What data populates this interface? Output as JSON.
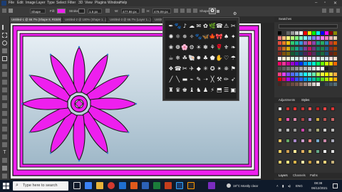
{
  "menu": {
    "items": [
      "File",
      "Edit",
      "Image",
      "Layer",
      "Type",
      "Select",
      "Filter",
      "3D",
      "View",
      "Plugins",
      "Window",
      "Help"
    ]
  },
  "options": {
    "mode_value": "Shape",
    "fill_label": "Fill:",
    "stroke_label": "Stroke:",
    "stroke_width": "1.5 px",
    "w_value": "477.86 px",
    "h_value": "478.09 px",
    "shape_label": "Shape:"
  },
  "tabs": [
    {
      "label": "Untitled-1 @ 66.7% (Shape 8, RGB/8) *"
    },
    {
      "label": "Untitled-2 @ 100% (Shape 1...)"
    },
    {
      "label": "Untitled-3 @ 66.7% (Layer 1...)"
    },
    {
      "label": "Untitled-4 @ 66.7%"
    },
    {
      "label": "Untitled-5 @ 66.7% (Shape..."
    }
  ],
  "panels": {
    "swatches_tab": "Swatches",
    "adjustments_tab": "Adjustments",
    "styles_tab": "Styles",
    "layers_tab": "Layers",
    "channels_tab": "Channels",
    "paths_tab": "Paths"
  },
  "colors": {
    "magenta": "#ee1fee",
    "flower_outline": "#1a1a1a",
    "anchor": "#3a7bd5",
    "frame_bg_top": "#e6eef4",
    "frame_bg_bottom": "#9fb8c8"
  },
  "picker": {
    "shapes": [
      "✒",
      "🐾",
      "♪",
      "☁",
      "✉",
      "✿",
      "🌿",
      "☎",
      "⚠",
      "✂",
      "✺",
      "⚛",
      "✵",
      "✧",
      "🐾",
      "🦋",
      "🍁",
      "🎀",
      "♠",
      "✦",
      "❀",
      "❁",
      "🌸",
      "⚙",
      "☀",
      "❃",
      "⚘",
      "🌹",
      "⚜",
      "❧",
      "☕",
      "❄",
      "☘",
      "🐚",
      "✸",
      "♣",
      "⬟",
      "✋",
      "♡",
      "☂",
      "❖",
      "☎",
      "✂",
      "✈",
      "◆",
      "✳",
      "✪",
      "✴",
      "⛯",
      "⚑",
      "╱",
      "╲",
      "▬",
      "⌁",
      "✎",
      "➝",
      "╳",
      "⚒",
      "✏",
      "➶",
      "♜",
      "♛",
      "♚",
      "♝",
      "♞",
      "♟",
      "⚡",
      "⬒",
      "☰",
      "▣"
    ]
  },
  "taskbar": {
    "search_placeholder": "Type here to search",
    "weather": "19°C  Mostly clear",
    "time": "08:38",
    "date": "06/12/2021",
    "lang": "ENG"
  }
}
